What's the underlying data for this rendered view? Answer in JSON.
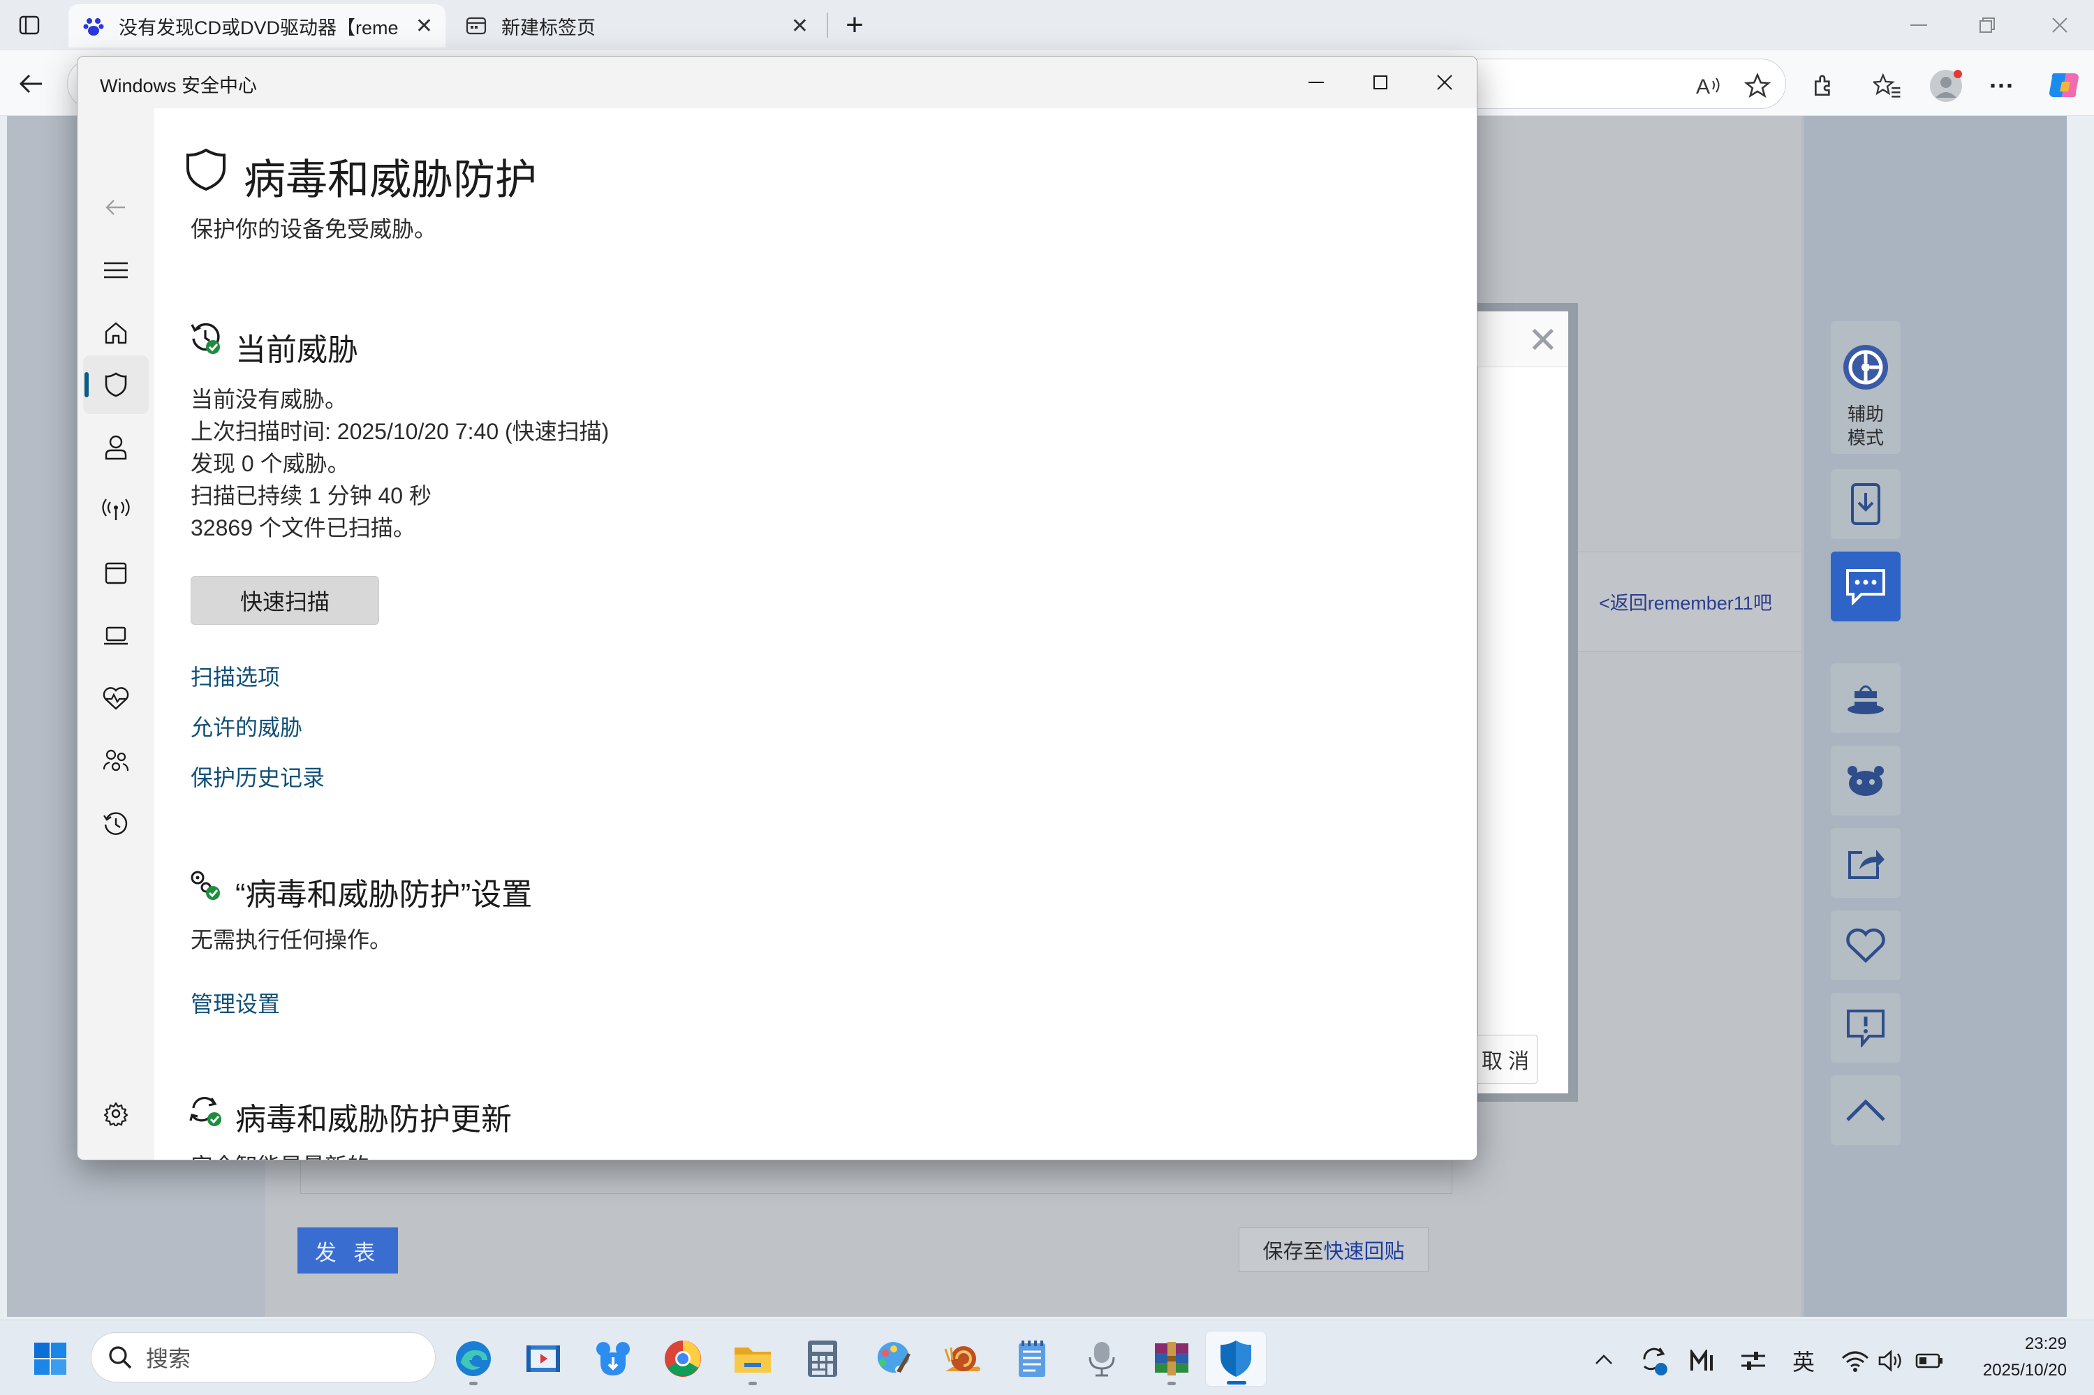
{
  "browser": {
    "tabs": [
      {
        "title": "没有发现CD或DVD驱动器【reme",
        "icon": "baidu-paw-icon"
      },
      {
        "title": "新建标签页",
        "icon": "new-tab-page-icon"
      }
    ],
    "new_tab": "+"
  },
  "webpage": {
    "back_link": "<返回remember11吧",
    "assist_mode": "辅助\n模式",
    "dialog_cancel": "取 消",
    "post_button": "发 表",
    "save_fast_prefix": "保存至",
    "save_fast_link": "快速回贴"
  },
  "security_window": {
    "title": "Windows 安全中心",
    "page_title": "病毒和威胁防护",
    "page_subtitle": "保护你的设备免受威胁。",
    "current_threats": {
      "heading": "当前威胁",
      "lines": [
        "当前没有威胁。",
        "上次扫描时间: 2025/10/20 7:40 (快速扫描)",
        "发现 0 个威胁。",
        "扫描已持续 1 分钟 40 秒",
        "32869 个文件已扫描。"
      ],
      "quick_scan_button": "快速扫描",
      "links": [
        "扫描选项",
        "允许的威胁",
        "保护历史记录"
      ]
    },
    "settings": {
      "heading": "“病毒和威胁防护”设置",
      "text": "无需执行任何操作。",
      "link": "管理设置"
    },
    "updates": {
      "heading": "病毒和威胁防护更新",
      "text": "安全智能是最新的。"
    }
  },
  "taskbar": {
    "search_placeholder": "搜索",
    "tray_language": "英",
    "clock_time": "23:29",
    "clock_date": "2025/10/20"
  },
  "colors": {
    "accent": "#0b5c86",
    "link": "#0f4f78",
    "check_green": "#1e8e3e",
    "post_blue": "#3a6dd0"
  }
}
